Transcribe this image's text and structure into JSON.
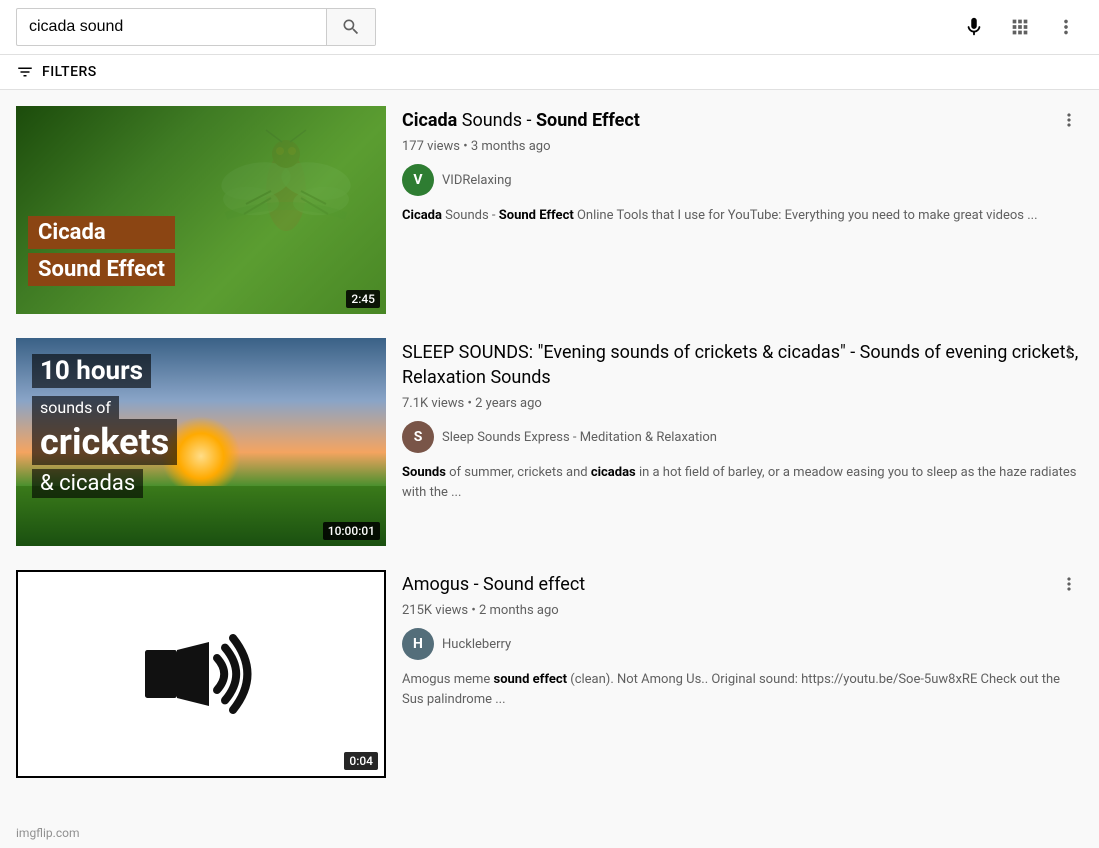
{
  "header": {
    "search_value": "cicada sound",
    "search_placeholder": "Search",
    "apps_icon": "⠿",
    "more_icon": "⋮",
    "mic_title": "Search by voice"
  },
  "filters": {
    "label": "FILTERS",
    "icon": "filter-icon"
  },
  "results": [
    {
      "id": "result-1",
      "title_parts": {
        "bold1": "Cicada",
        "normal1": " Sounds - ",
        "bold2": "Sound Effect"
      },
      "title_display": "Cicada Sounds - Sound Effect",
      "views": "177 views",
      "age": "3 months ago",
      "channel_name": "VIDRelaxing",
      "channel_initial": "V",
      "channel_color": "#2e7d32",
      "duration": "2:45",
      "desc_parts": {
        "bold1": "Cicada",
        "normal1": " Sounds - ",
        "bold2": "Sound Effect",
        "rest": " Online Tools that I use for YouTube: Everything you need to make great videos ..."
      },
      "thumb_type": "cicada",
      "overlay_line1": "Cicada",
      "overlay_line2": "Sound Effect"
    },
    {
      "id": "result-2",
      "title_display": "SLEEP SOUNDS: \"Evening sounds of crickets & cicadas\" - Sounds of evening crickets, Relaxation Sounds",
      "views": "7.1K views",
      "age": "2 years ago",
      "channel_name": "Sleep Sounds Express - Meditation & Relaxation",
      "channel_initial": "S",
      "channel_color": "#795548",
      "duration": "10:00:01",
      "desc_parts": {
        "bold1": "Sounds",
        "normal1": " of summer, crickets and ",
        "bold2": "cicadas",
        "rest": " in a hot field of barley, or a meadow easing you to sleep as the haze radiates with the ..."
      },
      "thumb_type": "sunset",
      "overlay_line1": "10 hours",
      "overlay_line2": "sounds of",
      "overlay_line3": "crickets",
      "overlay_line4": "& cicadas"
    },
    {
      "id": "result-3",
      "title_display": "Amogus - Sound effect",
      "views": "215K views",
      "age": "2 months ago",
      "channel_name": "Huckleberry",
      "channel_initial": "H",
      "channel_color": "#546e7a",
      "duration": "0:04",
      "desc_parts": {
        "normal1": "Amogus meme ",
        "bold1": "sound effect",
        "rest": " (clean). Not Among Us.. Original sound: https://youtu.be/Soe-5uw8xRE Check out the Sus palindrome ..."
      },
      "thumb_type": "sound"
    }
  ],
  "footer": {
    "text": "imgflip.com"
  }
}
